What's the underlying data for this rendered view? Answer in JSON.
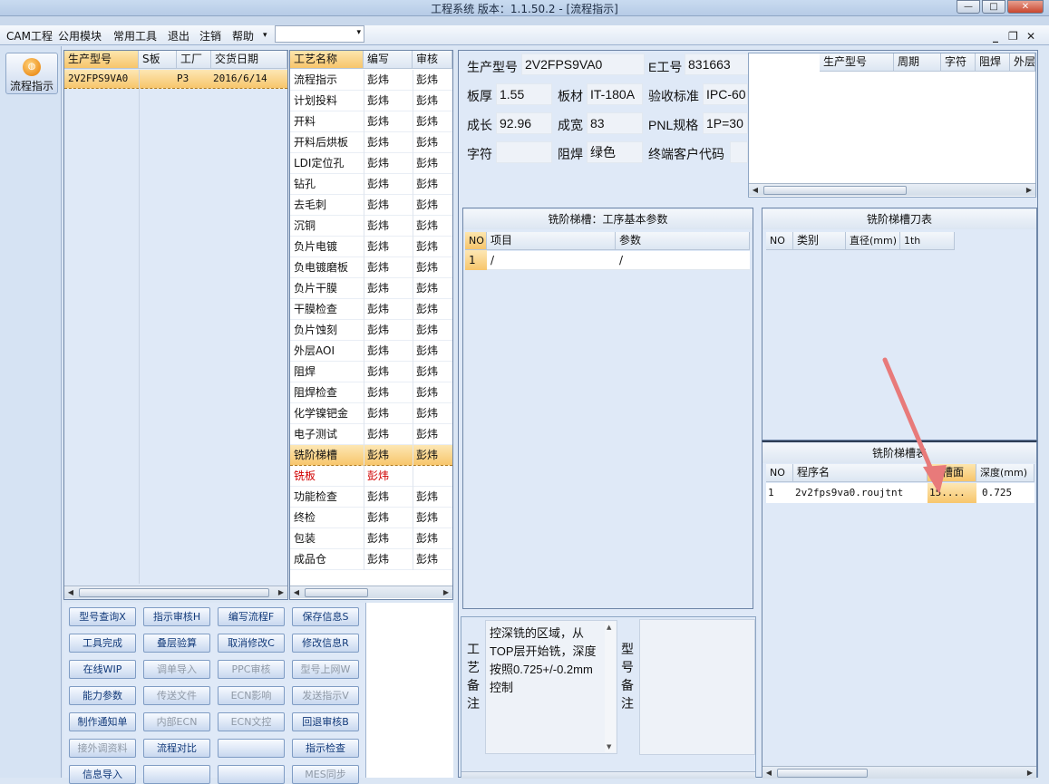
{
  "window": {
    "title": "工程系统   版本：1.1.50.2 - [流程指示]",
    "btn_min": "—",
    "btn_max": "□",
    "btn_close": "✕"
  },
  "menu": {
    "items": [
      "CAM工程",
      "公用模块",
      "常用工具",
      "退出",
      "注销",
      "帮助"
    ],
    "arrow": "▾",
    "combo_value": "",
    "combo_arrow": "▾",
    "mdi_min": "_",
    "mdi_restore": "❐",
    "mdi_close": "✕"
  },
  "side": {
    "flow_label": "流程指示",
    "icon_glyph": "◍"
  },
  "model_list": {
    "headers": [
      "生产型号",
      "S板",
      "工厂",
      "交货日期"
    ],
    "rows": [
      {
        "model": "2V2FPS9VA0",
        "sboard": "",
        "factory": "P3",
        "date": "2016/6/14"
      }
    ]
  },
  "process_list": {
    "headers": [
      "工艺名称",
      "编写",
      "审核"
    ],
    "rows": [
      {
        "name": "流程指示",
        "writer": "彭炜",
        "reviewer": "彭炜"
      },
      {
        "name": "计划投料",
        "writer": "彭炜",
        "reviewer": "彭炜"
      },
      {
        "name": "开料",
        "writer": "彭炜",
        "reviewer": "彭炜"
      },
      {
        "name": "开料后烘板",
        "writer": "彭炜",
        "reviewer": "彭炜"
      },
      {
        "name": "LDI定位孔",
        "writer": "彭炜",
        "reviewer": "彭炜"
      },
      {
        "name": "钻孔",
        "writer": "彭炜",
        "reviewer": "彭炜"
      },
      {
        "name": "去毛刺",
        "writer": "彭炜",
        "reviewer": "彭炜"
      },
      {
        "name": "沉铜",
        "writer": "彭炜",
        "reviewer": "彭炜"
      },
      {
        "name": "负片电镀",
        "writer": "彭炜",
        "reviewer": "彭炜"
      },
      {
        "name": "负电镀磨板",
        "writer": "彭炜",
        "reviewer": "彭炜"
      },
      {
        "name": "负片干膜",
        "writer": "彭炜",
        "reviewer": "彭炜"
      },
      {
        "name": "干膜检查",
        "writer": "彭炜",
        "reviewer": "彭炜"
      },
      {
        "name": "负片蚀刻",
        "writer": "彭炜",
        "reviewer": "彭炜"
      },
      {
        "name": "外层AOI",
        "writer": "彭炜",
        "reviewer": "彭炜"
      },
      {
        "name": "阻焊",
        "writer": "彭炜",
        "reviewer": "彭炜"
      },
      {
        "name": "阻焊检查",
        "writer": "彭炜",
        "reviewer": "彭炜"
      },
      {
        "name": "化学镍钯金",
        "writer": "彭炜",
        "reviewer": "彭炜"
      },
      {
        "name": "电子测试",
        "writer": "彭炜",
        "reviewer": "彭炜"
      },
      {
        "name": "铣阶梯槽",
        "writer": "彭炜",
        "reviewer": "彭炜"
      },
      {
        "name": "铣板",
        "writer": "彭炜",
        "reviewer": ""
      },
      {
        "name": "功能检查",
        "writer": "彭炜",
        "reviewer": "彭炜"
      },
      {
        "name": "终检",
        "writer": "彭炜",
        "reviewer": "彭炜"
      },
      {
        "name": "包装",
        "writer": "彭炜",
        "reviewer": "彭炜"
      },
      {
        "name": "成品仓",
        "writer": "彭炜",
        "reviewer": "彭炜"
      }
    ]
  },
  "buttons": [
    [
      "型号查询X",
      "指示审核H",
      "编写流程F",
      "保存信息S"
    ],
    [
      "工具完成",
      "叠层验算",
      "取消修改C",
      "修改信息R"
    ],
    [
      "在线WIP",
      "调单导入",
      "PPC审核",
      "型号上网W"
    ],
    [
      "能力参数",
      "传送文件",
      "ECN影响",
      "发送指示V"
    ],
    [
      "制作通知单",
      "内部ECN",
      "ECN文控",
      "回退审核B"
    ],
    [
      "接外调资料",
      "流程对比",
      "",
      "指示检查"
    ],
    [
      "信息导入",
      "",
      "",
      "MES同步"
    ]
  ],
  "info": {
    "model_label": "生产型号",
    "model_value": "2V2FPS9VA0",
    "eno_label": "E工号",
    "eno_value": "831663",
    "thick_label": "板厚",
    "thick_value": "1.55",
    "material_label": "板材",
    "material_value": "IT-180A",
    "accept_label": "验收标准",
    "accept_value": "IPC-60",
    "len_label": "成长",
    "len_value": "92.96",
    "wid_label": "成宽",
    "wid_value": "83",
    "pnl_label": "PNL规格",
    "pnl_value": "1P=30",
    "char_label": "字符",
    "char_value": "",
    "mask_label": "阻焊",
    "mask_value": "绿色",
    "cust_label": "终端客户代码",
    "cust_value": ""
  },
  "mini_table": {
    "headers": [
      "生产型号",
      "周期",
      "字符",
      "阻焊",
      "外层"
    ]
  },
  "params": {
    "title": "铣阶梯槽：工序基本参数",
    "headers": [
      "NO",
      "项目",
      "参数"
    ],
    "rows": [
      {
        "no": "1",
        "item": "/",
        "param": "/"
      }
    ]
  },
  "tools": {
    "title": "铣阶梯槽刀表",
    "headers": [
      "NO",
      "类别",
      "直径(mm)",
      "1th"
    ]
  },
  "slots": {
    "title": "铣阶梯槽表",
    "headers": [
      "NO",
      "程序名",
      "铣槽面",
      "深度(mm)"
    ],
    "rows": [
      {
        "no": "1",
        "program": "2v2fps9va0.roujtnt",
        "face": "15....",
        "depth": "0.725"
      }
    ]
  },
  "remarks": {
    "process_label": "工艺备注",
    "process_text": "控深铣的区域，从TOP层开始铣，深度按照0.725+/-0.2mm控制",
    "model_label": "型号备注",
    "model_text": ""
  }
}
